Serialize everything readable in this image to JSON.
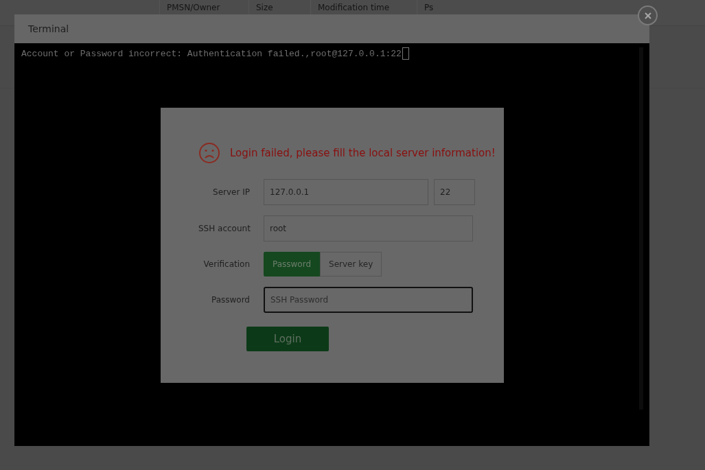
{
  "background_table": {
    "columns": [
      "PMSN/Owner",
      "Size",
      "Modification time",
      "Ps"
    ]
  },
  "terminal": {
    "title": "Terminal",
    "output": "Account or Password incorrect: Authentication failed.,root@127.0.0.1:22"
  },
  "login_dialog": {
    "message": "Login failed, please fill the local server information!",
    "server_ip": {
      "label": "Server IP",
      "value": "127.0.0.1",
      "port": "22"
    },
    "account": {
      "label": "SSH account",
      "value": "root"
    },
    "verification": {
      "label": "Verification",
      "options": [
        {
          "label": "Password",
          "selected": true
        },
        {
          "label": "Server key",
          "selected": false
        }
      ]
    },
    "password": {
      "label": "Password",
      "placeholder": "SSH Password"
    },
    "login_button": "Login"
  }
}
